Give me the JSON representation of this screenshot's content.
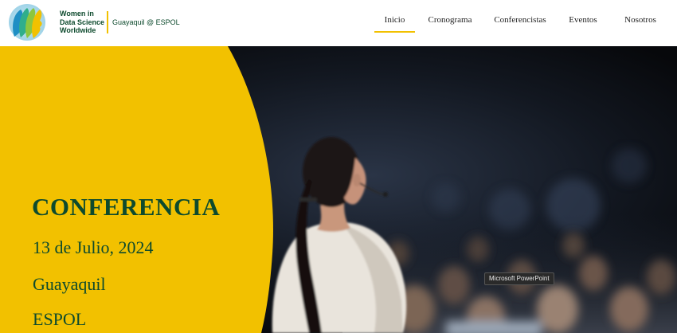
{
  "header": {
    "logo": {
      "icon": "wids-faces-logo-icon",
      "lines": [
        "Women in",
        "Data Science",
        "Worldwide"
      ],
      "subtitle": "Guayaquil @ ESPOL"
    },
    "nav": [
      {
        "label": "Inicio",
        "active": true
      },
      {
        "label": "Cronograma",
        "active": false
      },
      {
        "label": "Conferencistas",
        "active": false
      },
      {
        "label": "Eventos",
        "active": false
      },
      {
        "label": "Nosotros",
        "active": false
      }
    ]
  },
  "hero": {
    "title": "CONFERENCIA",
    "date": "13 de Julio, 2024",
    "city": "Guayaquil",
    "venue": "ESPOL",
    "image": "speaker-on-stage-audience-photo"
  },
  "tooltip": "Microsoft PowerPoint",
  "colors": {
    "accent_yellow": "#f2c100",
    "brand_green": "#0d4a2d",
    "background_dark": "#0c0d10"
  }
}
